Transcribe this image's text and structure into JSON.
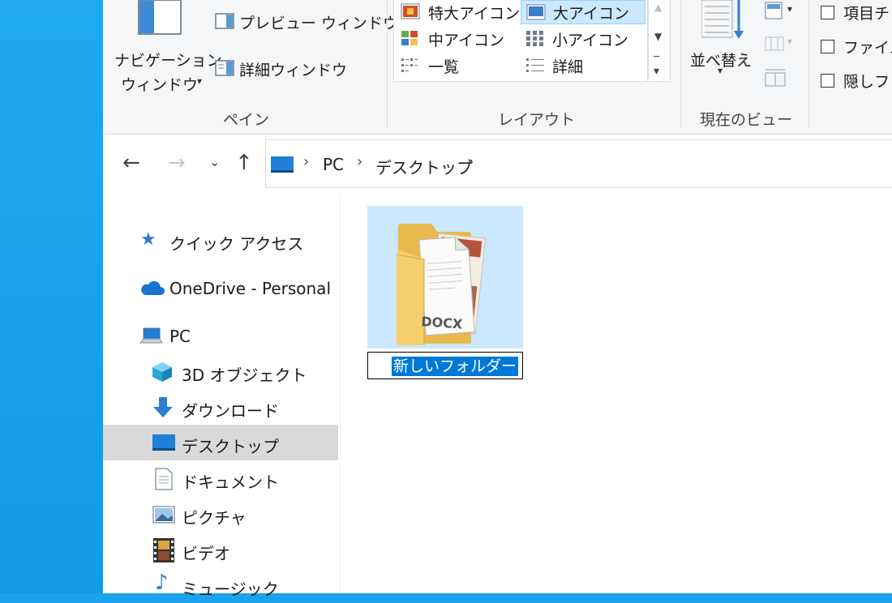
{
  "ribbon": {
    "pane": {
      "nav_pane_line1": "ナビゲーション",
      "nav_pane_line2": "ウィンドウ",
      "preview_pane": "プレビュー ウィンドウ",
      "details_pane": "詳細ウィンドウ",
      "group_label": "ペイン"
    },
    "layout": {
      "items": [
        "特大アイコン",
        "大アイコン",
        "中アイコン",
        "小アイコン",
        "一覧",
        "詳細"
      ],
      "selected": "大アイコン",
      "group_label": "レイアウト"
    },
    "current_view": {
      "sort_label": "並べ替え",
      "group_label": "現在のビュー"
    },
    "show_hide": {
      "items": [
        "項目チ",
        "ファイル",
        "隠しフ"
      ]
    }
  },
  "address_bar": {
    "crumbs": [
      "PC",
      "デスクトップ"
    ]
  },
  "nav_pane": {
    "items": [
      "クイック アクセス",
      "OneDrive - Personal",
      "PC",
      "3D オブジェクト",
      "ダウンロード",
      "デスクトップ",
      "ドキュメント",
      "ピクチャ",
      "ビデオ",
      "ミュージック"
    ],
    "selected": "デスクトップ"
  },
  "content": {
    "folder_doc_label": "DOCX",
    "rename_value": "新しいフォルダー"
  },
  "colors": {
    "accent": "#0078d7",
    "selection_bg": "#cce8ff",
    "desktop_bg": "#1aa3ec"
  }
}
